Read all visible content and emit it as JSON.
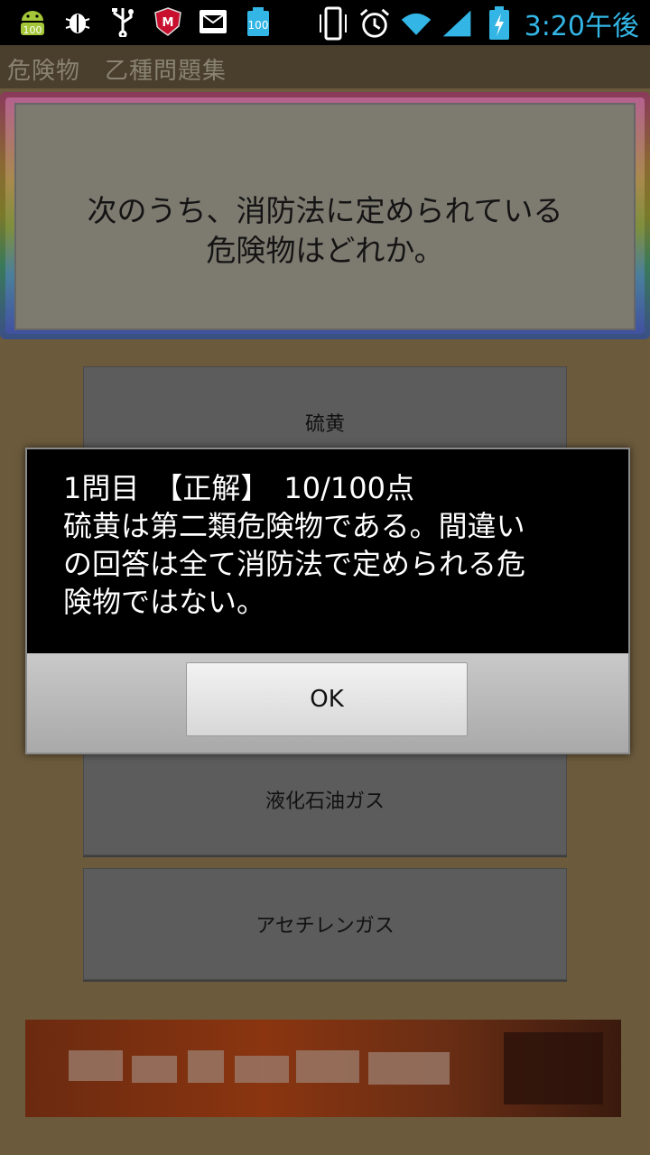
{
  "status_bar": {
    "time": "3:20午後",
    "icons": [
      "android-icon",
      "bug-icon",
      "usb-icon",
      "mcafee-icon",
      "mail-icon",
      "battery-100-icon",
      "vibrate-icon",
      "alarm-icon",
      "wifi-icon",
      "signal-icon",
      "battery-charging-icon"
    ],
    "badge_100": "100",
    "badge_100b": "100"
  },
  "app": {
    "title": "危険物　乙種問題集"
  },
  "question": {
    "text_line1": "次のうち、消防法に定められている",
    "text_line2": "危険物はどれか。"
  },
  "choices": [
    {
      "label": "硫黄"
    },
    {
      "label": "液化石油ガス"
    },
    {
      "label": "アセチレンガス"
    }
  ],
  "dialog": {
    "line1": "1問目　【正解】　10/100点",
    "line2": "硫黄は第二類危険物である。間違い",
    "line3": "の回答は全て消防法で定められる危",
    "line4": "険物ではない。",
    "ok_label": "OK"
  },
  "colors": {
    "accent_time": "#33b5e5",
    "dialog_bg": "#000000"
  }
}
